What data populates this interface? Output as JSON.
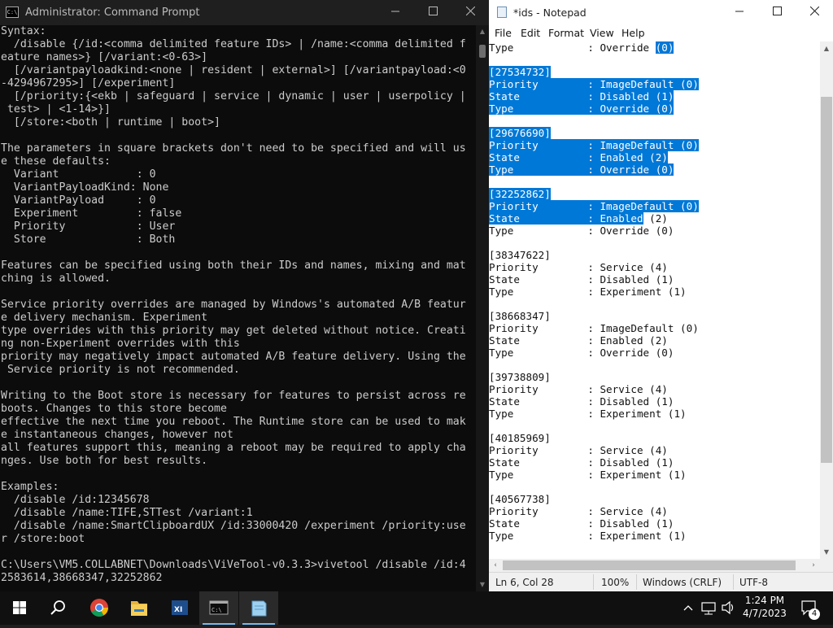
{
  "cmd": {
    "title": "Administrator: Command Prompt",
    "lines": [
      "Syntax:",
      "  /disable {/id:<comma delimited feature IDs> | /name:<comma delimited f",
      "eature names>} [/variant:<0-63>]",
      "  [/variantpayloadkind:<none | resident | external>] [/variantpayload:<0",
      "-4294967295>] [/experiment]",
      "  [/priority:{<ekb | safeguard | service | dynamic | user | userpolicy |",
      " test> | <1-14>}]",
      "  [/store:<both | runtime | boot>]",
      "",
      "The parameters in square brackets don't need to be specified and will us",
      "e these defaults:",
      "  Variant            : 0",
      "  VariantPayloadKind: None",
      "  VariantPayload     : 0",
      "  Experiment         : false",
      "  Priority           : User",
      "  Store              : Both",
      "",
      "Features can be specified using both their IDs and names, mixing and mat",
      "ching is allowed.",
      "",
      "Service priority overrides are managed by Windows's automated A/B featur",
      "e delivery mechanism. Experiment",
      "type overrides with this priority may get deleted without notice. Creati",
      "ng non-Experiment overrides with this",
      "priority may negatively impact automated A/B feature delivery. Using the",
      " Service priority is not recommended.",
      "",
      "Writing to the Boot store is necessary for features to persist across re",
      "boots. Changes to this store become",
      "effective the next time you reboot. The Runtime store can be used to mak",
      "e instantaneous changes, however not",
      "all features support this, meaning a reboot may be required to apply cha",
      "nges. Use both for best results.",
      "",
      "Examples:",
      "  /disable /id:12345678",
      "  /disable /name:TIFE,STTest /variant:1",
      "  /disable /name:SmartClipboardUX /id:33000420 /experiment /priority:use",
      "r /store:boot",
      "",
      "C:\\Users\\VM5.COLLABNET\\Downloads\\ViVeTool-v0.3.3>vivetool /disable /id:4",
      "2583614,38668347,32252862"
    ]
  },
  "notepad": {
    "title": "*ids - Notepad",
    "menu": [
      "File",
      "Edit",
      "Format",
      "View",
      "Help"
    ],
    "lines": [
      {
        "pre": "Type            : Override ",
        "sel": "(0)",
        "post": ""
      },
      {
        "pre": "",
        "sel": "",
        "post": ""
      },
      {
        "pre": "",
        "sel": "[27534732]",
        "post": ""
      },
      {
        "pre": "",
        "sel": "Priority        : ImageDefault (0)",
        "post": ""
      },
      {
        "pre": "",
        "sel": "State           : Disabled (1)",
        "post": ""
      },
      {
        "pre": "",
        "sel": "Type            : Override (0)",
        "post": ""
      },
      {
        "pre": "",
        "sel": "",
        "post": ""
      },
      {
        "pre": "",
        "sel": "[29676690]",
        "post": ""
      },
      {
        "pre": "",
        "sel": "Priority        : ImageDefault (0)",
        "post": ""
      },
      {
        "pre": "",
        "sel": "State           : Enabled (2)",
        "post": ""
      },
      {
        "pre": "",
        "sel": "Type            : Override (0)",
        "post": ""
      },
      {
        "pre": "",
        "sel": "",
        "post": ""
      },
      {
        "pre": "",
        "sel": "[32252862]",
        "post": ""
      },
      {
        "pre": "",
        "sel": "Priority        : ImageDefault (0)",
        "post": ""
      },
      {
        "pre": "",
        "sel": "State           : Enabled",
        "post": " (2)"
      },
      {
        "pre": "Type            : Override (0)",
        "sel": "",
        "post": ""
      },
      {
        "pre": "",
        "sel": "",
        "post": ""
      },
      {
        "pre": "[38347622]",
        "sel": "",
        "post": ""
      },
      {
        "pre": "Priority        : Service (4)",
        "sel": "",
        "post": ""
      },
      {
        "pre": "State           : Disabled (1)",
        "sel": "",
        "post": ""
      },
      {
        "pre": "Type            : Experiment (1)",
        "sel": "",
        "post": ""
      },
      {
        "pre": "",
        "sel": "",
        "post": ""
      },
      {
        "pre": "[38668347]",
        "sel": "",
        "post": ""
      },
      {
        "pre": "Priority        : ImageDefault (0)",
        "sel": "",
        "post": ""
      },
      {
        "pre": "State           : Enabled (2)",
        "sel": "",
        "post": ""
      },
      {
        "pre": "Type            : Override (0)",
        "sel": "",
        "post": ""
      },
      {
        "pre": "",
        "sel": "",
        "post": ""
      },
      {
        "pre": "[39738809]",
        "sel": "",
        "post": ""
      },
      {
        "pre": "Priority        : Service (4)",
        "sel": "",
        "post": ""
      },
      {
        "pre": "State           : Disabled (1)",
        "sel": "",
        "post": ""
      },
      {
        "pre": "Type            : Experiment (1)",
        "sel": "",
        "post": ""
      },
      {
        "pre": "",
        "sel": "",
        "post": ""
      },
      {
        "pre": "[40185969]",
        "sel": "",
        "post": ""
      },
      {
        "pre": "Priority        : Service (4)",
        "sel": "",
        "post": ""
      },
      {
        "pre": "State           : Disabled (1)",
        "sel": "",
        "post": ""
      },
      {
        "pre": "Type            : Experiment (1)",
        "sel": "",
        "post": ""
      },
      {
        "pre": "",
        "sel": "",
        "post": ""
      },
      {
        "pre": "[40567738]",
        "sel": "",
        "post": ""
      },
      {
        "pre": "Priority        : Service (4)",
        "sel": "",
        "post": ""
      },
      {
        "pre": "State           : Disabled (1)",
        "sel": "",
        "post": ""
      },
      {
        "pre": "Type            : Experiment (1)",
        "sel": "",
        "post": ""
      }
    ],
    "status": {
      "position": "Ln 6, Col 28",
      "zoom": "100%",
      "line_endings": "Windows (CRLF)",
      "encoding": "UTF-8"
    }
  },
  "taskbar": {
    "apps": [
      "start-icon",
      "search-icon",
      "chrome-icon",
      "file-explorer-icon",
      "powershell-ise-icon",
      "command-prompt-icon",
      "notepad-icon"
    ],
    "time": "1:24 PM",
    "date": "4/7/2023",
    "notification_count": "4"
  },
  "colors": {
    "selection": "#0078d7",
    "console_bg": "#0c0c0c",
    "console_text": "#cccccc",
    "taskbar_bg": "#101010"
  }
}
